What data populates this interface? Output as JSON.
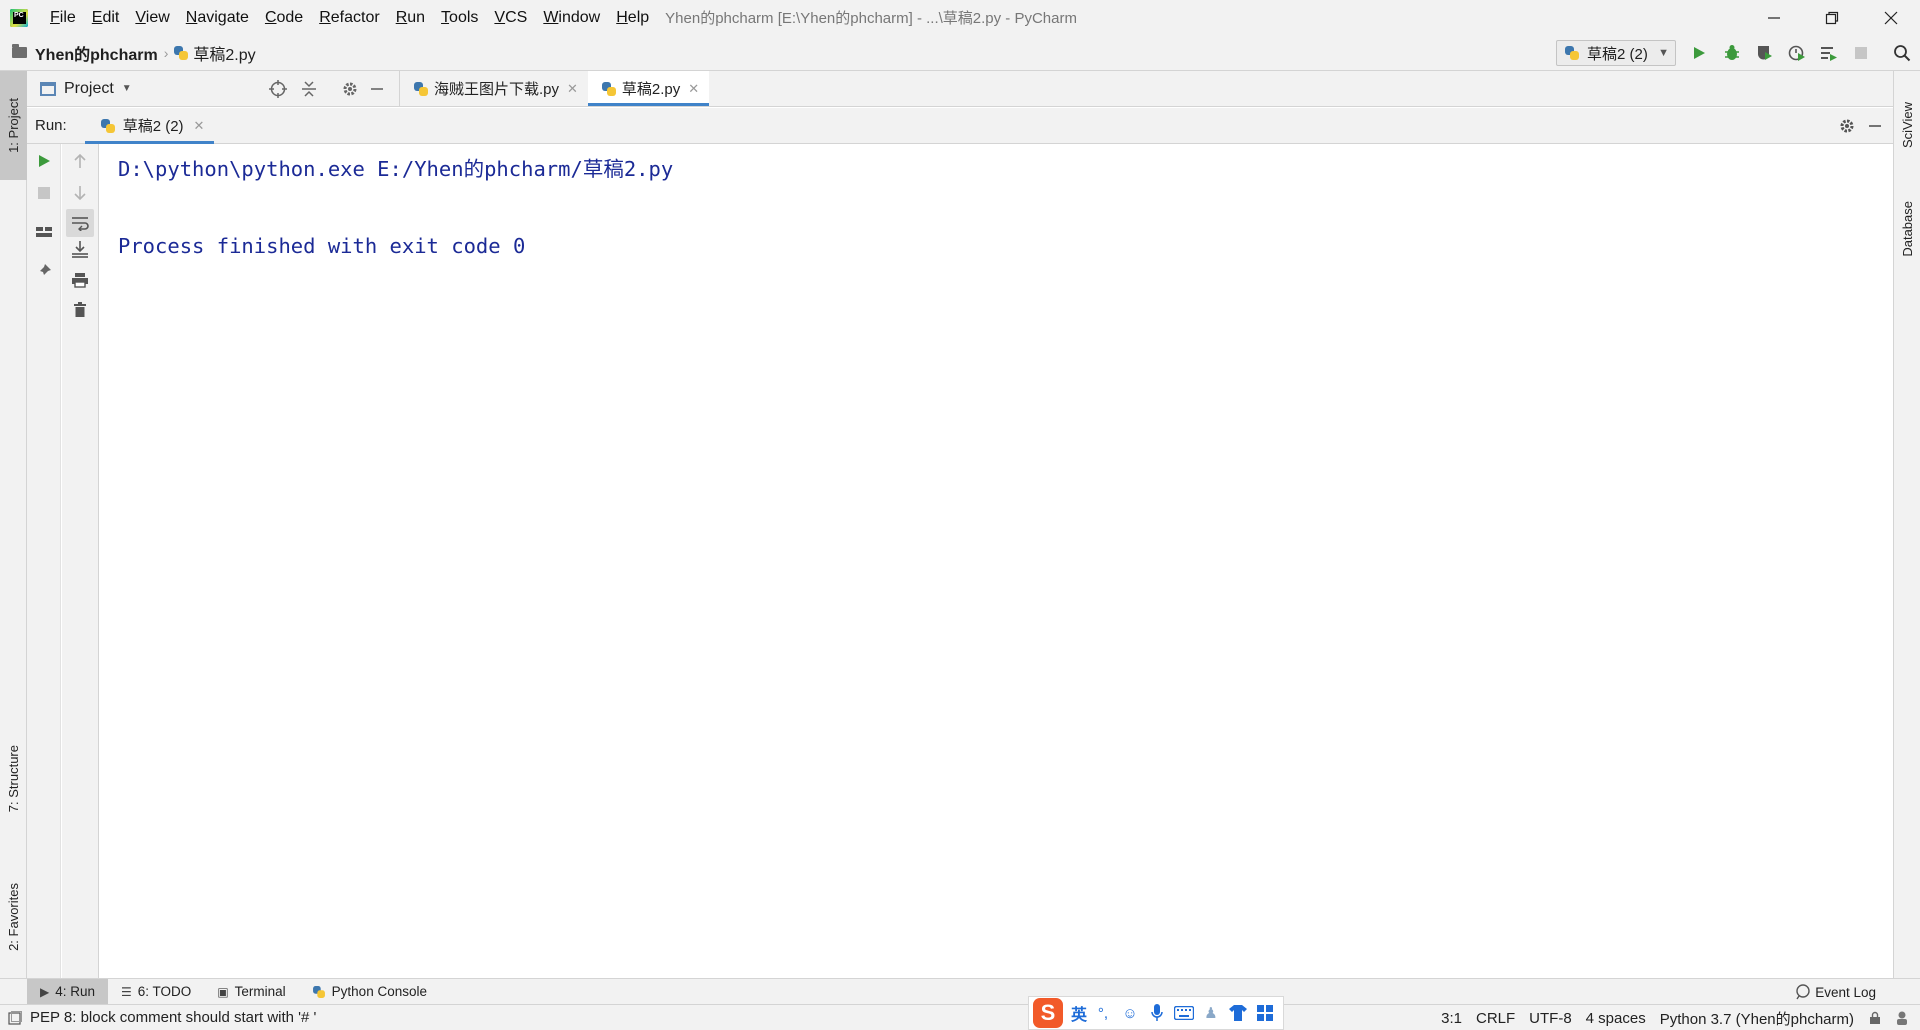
{
  "titlebar": {
    "menu": [
      "File",
      "Edit",
      "View",
      "Navigate",
      "Code",
      "Refactor",
      "Run",
      "Tools",
      "VCS",
      "Window",
      "Help"
    ],
    "window_title": "Yhen的phcharm [E:\\Yhen的phcharm] - ...\\草稿2.py - PyCharm"
  },
  "navbar": {
    "project": "Yhen的phcharm",
    "file": "草稿2.py",
    "run_config": "草稿2 (2)"
  },
  "left_stripe": {
    "project_tab": "1: Project",
    "structure_tab": "7: Structure",
    "favorites_tab": "2: Favorites"
  },
  "right_stripe": {
    "sciview_tab": "SciView",
    "database_tab": "Database"
  },
  "project_panel": {
    "title": "Project"
  },
  "editor_tabs": [
    {
      "label": "海贼王图片下载.py",
      "active": false
    },
    {
      "label": "草稿2.py",
      "active": true
    }
  ],
  "run_window": {
    "label": "Run:",
    "tab": "草稿2 (2)",
    "console_lines": [
      "D:\\python\\python.exe E:/Yhen的phcharm/草稿2.py",
      "",
      "Process finished with exit code 0"
    ]
  },
  "bottom_tabs": {
    "run": "4: Run",
    "todo": "6: TODO",
    "terminal": "Terminal",
    "python_console": "Python Console",
    "event_log": "Event Log"
  },
  "statusbar": {
    "message": "PEP 8: block comment should start with '# '",
    "position": "3:1",
    "line_sep": "CRLF",
    "encoding": "UTF-8",
    "indent": "4 spaces",
    "interpreter": "Python 3.7 (Yhen的phcharm)"
  },
  "ime": {
    "mode": "英"
  },
  "colors": {
    "console_text": "#1b2a96",
    "tab_underline": "#4083c9",
    "run_green": "#3c9a3c"
  }
}
